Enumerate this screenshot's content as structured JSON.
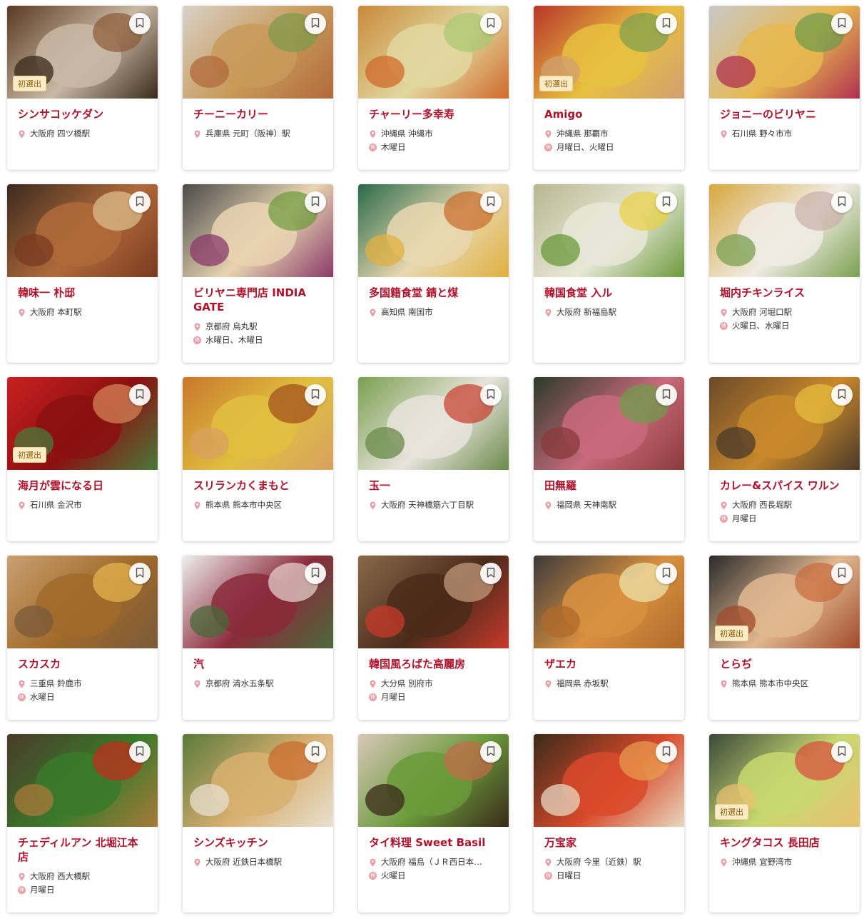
{
  "bookmark_icon": "bookmark-icon",
  "location_icon": "map-pin-icon",
  "closed_icon": "closed-day-icon",
  "colors": {
    "accent": "#b0112b",
    "badge_bg": "#fbecc7",
    "pin": "#e8a0a8"
  },
  "cards": [
    {
      "name": "シンサコッケダン",
      "location": "大阪府 四ツ橋駅",
      "closed": "",
      "badge": "初選出",
      "photo": [
        "#5a3a22",
        "#c9b8a4",
        "#8a5a36",
        "#3a2a1a"
      ]
    },
    {
      "name": "チーニーカリー",
      "location": "兵庫県 元町（阪神）駅",
      "closed": "",
      "badge": "",
      "photo": [
        "#d8d2c8",
        "#c89a5a",
        "#7a9a4a",
        "#b06a3a"
      ]
    },
    {
      "name": "チャーリー多幸寿",
      "location": "沖縄県 沖縄市",
      "closed": "木曜日",
      "badge": "",
      "photo": [
        "#c88a3a",
        "#e2d8a0",
        "#a8c870",
        "#d06a2a"
      ]
    },
    {
      "name": "Amigo",
      "location": "沖縄県 那覇市",
      "closed": "月曜日、火曜日",
      "badge": "初選出",
      "photo": [
        "#b8362a",
        "#e8c040",
        "#7aa050",
        "#d0a070"
      ]
    },
    {
      "name": "ジョニーのビリヤニ",
      "location": "石川県 野々市市",
      "closed": "",
      "badge": "",
      "photo": [
        "#c8c8c8",
        "#e6b850",
        "#6a9a4a",
        "#b03050"
      ]
    },
    {
      "name": "韓味一 朴邸",
      "location": "大阪府 本町駅",
      "closed": "",
      "badge": "",
      "photo": [
        "#3a2a1e",
        "#b06a3a",
        "#e0c090",
        "#7a3a20"
      ]
    },
    {
      "name": "ビリヤニ専門店 INDIA GATE",
      "location": "京都府 烏丸駅",
      "closed": "水曜日、木曜日",
      "badge": "",
      "photo": [
        "#4a4a4a",
        "#e8d4b0",
        "#6a9a3a",
        "#8a3a6a"
      ]
    },
    {
      "name": "多国籍食堂 錆と煤",
      "location": "高知県 南国市",
      "closed": "",
      "badge": "",
      "photo": [
        "#2a6a4a",
        "#e8d8b0",
        "#c86a2a",
        "#e0b040"
      ]
    },
    {
      "name": "韓国食堂 入ル",
      "location": "大阪府 新福島駅",
      "closed": "",
      "badge": "",
      "photo": [
        "#b8b890",
        "#e8e8d8",
        "#e8d040",
        "#6a9a3a"
      ]
    },
    {
      "name": "堀内チキンライス",
      "location": "大阪府 河堀口駅",
      "closed": "火曜日、水曜日",
      "badge": "",
      "photo": [
        "#d8a840",
        "#f0ece4",
        "#c8b0a8",
        "#7aa050"
      ]
    },
    {
      "name": "海月が雲になる日",
      "location": "石川県 金沢市",
      "closed": "",
      "badge": "初選出",
      "photo": [
        "#c82020",
        "#8a1010",
        "#d88a5a",
        "#4a7a3a"
      ]
    },
    {
      "name": "スリランカくまもと",
      "location": "熊本県 熊本市中央区",
      "closed": "",
      "badge": "",
      "photo": [
        "#c8782a",
        "#e0c040",
        "#a04a1a",
        "#d8a060"
      ]
    },
    {
      "name": "玉一",
      "location": "大阪府 天神橋筋六丁目駅",
      "closed": "",
      "badge": "",
      "photo": [
        "#7aa050",
        "#e8e4dc",
        "#c83a2a",
        "#6a8a4a"
      ]
    },
    {
      "name": "田無羅",
      "location": "福岡県 天神南駅",
      "closed": "",
      "badge": "",
      "photo": [
        "#2a3a2a",
        "#c86a7a",
        "#6aa04a",
        "#8a3a3a"
      ]
    },
    {
      "name": "カレー&スパイス ワルン",
      "location": "大阪府 西長堀駅",
      "closed": "月曜日",
      "badge": "",
      "photo": [
        "#6a4a2a",
        "#c8882a",
        "#e8c040",
        "#4a3a2a"
      ]
    },
    {
      "name": "スカスカ",
      "location": "三重県 鈴鹿市",
      "closed": "水曜日",
      "badge": "",
      "photo": [
        "#c8a070",
        "#a06a2a",
        "#e8b850",
        "#7a5a3a"
      ]
    },
    {
      "name": "汽",
      "location": "京都府 清水五条駅",
      "closed": "",
      "badge": "",
      "photo": [
        "#eeeeee",
        "#8a2a3a",
        "#e8d8d0",
        "#4a6a3a"
      ]
    },
    {
      "name": "韓国風ろばた高麗房",
      "location": "大分県 別府市",
      "closed": "月曜日",
      "badge": "",
      "photo": [
        "#8a6a4a",
        "#4a2a1a",
        "#c8a080",
        "#c83a2a"
      ]
    },
    {
      "name": "ザエカ",
      "location": "福岡県 赤坂駅",
      "closed": "",
      "badge": "",
      "photo": [
        "#3a3a3a",
        "#d89040",
        "#f0e8b0",
        "#b06a2a"
      ]
    },
    {
      "name": "とらぢ",
      "location": "熊本県 熊本市中央区",
      "closed": "",
      "badge": "初選出",
      "photo": [
        "#2a2a2a",
        "#e0b890",
        "#c86a3a",
        "#a04a2a"
      ]
    },
    {
      "name": "チェディルアン 北堀江本店",
      "location": "大阪府 西大橋駅",
      "closed": "月曜日",
      "badge": "",
      "photo": [
        "#4a3a2a",
        "#3a7a2a",
        "#c82a1a",
        "#a87a3a"
      ]
    },
    {
      "name": "シンズキッチン",
      "location": "大阪府 近鉄日本橋駅",
      "closed": "",
      "badge": "",
      "photo": [
        "#5a7a3a",
        "#d8b070",
        "#c8682a",
        "#e8e0d0"
      ]
    },
    {
      "name": "タイ料理 Sweet Basil",
      "location": "大阪府 福島（ＪＲ西日本…",
      "closed": "火曜日",
      "badge": "",
      "photo": [
        "#d8c8b8",
        "#6a9a3a",
        "#c86a4a",
        "#3a2a1a"
      ]
    },
    {
      "name": "万宝家",
      "location": "大阪府 今里（近鉄）駅",
      "closed": "日曜日",
      "badge": "",
      "photo": [
        "#3a2a1a",
        "#d84a2a",
        "#e8a050",
        "#e8d8c0"
      ]
    },
    {
      "name": "キングタコス 長田店",
      "location": "沖縄県 宜野湾市",
      "closed": "",
      "badge": "初選出",
      "photo": [
        "#3a4a3a",
        "#c8d870",
        "#d84a3a",
        "#e8c070"
      ]
    }
  ]
}
